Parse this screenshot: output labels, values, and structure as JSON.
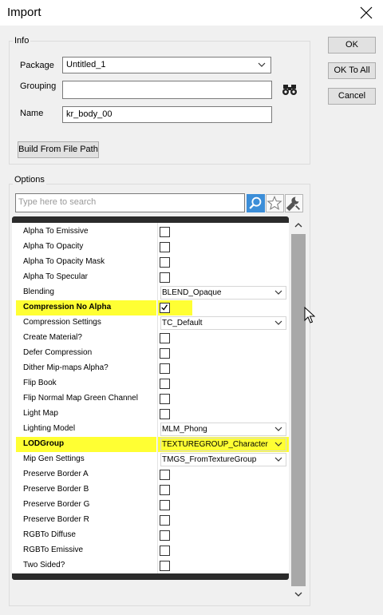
{
  "window": {
    "title": "Import"
  },
  "buttons": {
    "ok": "OK",
    "ok_to_all": "OK To All",
    "cancel": "Cancel"
  },
  "info": {
    "label": "Info",
    "package_label": "Package",
    "package_value": "Untitled_1",
    "grouping_label": "Grouping",
    "grouping_value": "",
    "name_label": "Name",
    "name_value": "kr_body_00",
    "build_button": "Build From File Path"
  },
  "options": {
    "label": "Options",
    "search_placeholder": "Type here to search",
    "rows": [
      {
        "name": "Alpha To Emissive",
        "type": "checkbox",
        "checked": false
      },
      {
        "name": "Alpha To Opacity",
        "type": "checkbox",
        "checked": false
      },
      {
        "name": "Alpha To Opacity Mask",
        "type": "checkbox",
        "checked": false
      },
      {
        "name": "Alpha To Specular",
        "type": "checkbox",
        "checked": false
      },
      {
        "name": "Blending",
        "type": "dropdown",
        "value": "BLEND_Opaque"
      },
      {
        "name": "Compression No Alpha",
        "type": "checkbox",
        "checked": true,
        "highlight": true
      },
      {
        "name": "Compression Settings",
        "type": "dropdown",
        "value": "TC_Default"
      },
      {
        "name": "Create Material?",
        "type": "checkbox",
        "checked": false
      },
      {
        "name": "Defer Compression",
        "type": "checkbox",
        "checked": false
      },
      {
        "name": "Dither Mip-maps Alpha?",
        "type": "checkbox",
        "checked": false
      },
      {
        "name": "Flip Book",
        "type": "checkbox",
        "checked": false
      },
      {
        "name": "Flip Normal Map Green Channel",
        "type": "checkbox",
        "checked": false
      },
      {
        "name": "Light Map",
        "type": "checkbox",
        "checked": false
      },
      {
        "name": "Lighting Model",
        "type": "dropdown",
        "value": "MLM_Phong"
      },
      {
        "name": "LODGroup",
        "type": "dropdown",
        "value": "TEXTUREGROUP_Character",
        "highlight": true
      },
      {
        "name": "Mip Gen Settings",
        "type": "dropdown",
        "value": "TMGS_FromTextureGroup"
      },
      {
        "name": "Preserve Border A",
        "type": "checkbox",
        "checked": false
      },
      {
        "name": "Preserve Border B",
        "type": "checkbox",
        "checked": false
      },
      {
        "name": "Preserve Border G",
        "type": "checkbox",
        "checked": false
      },
      {
        "name": "Preserve Border R",
        "type": "checkbox",
        "checked": false
      },
      {
        "name": "RGBTo Diffuse",
        "type": "checkbox",
        "checked": false
      },
      {
        "name": "RGBTo Emissive",
        "type": "checkbox",
        "checked": false
      },
      {
        "name": "Two Sided?",
        "type": "checkbox",
        "checked": false
      }
    ]
  },
  "colors": {
    "highlight": "#ffff33",
    "header_bar": "#2b2b2b",
    "search_button": "#3c8ed8"
  },
  "icons": {
    "close": "close-icon",
    "browse": "binoculars-icon",
    "search": "magnifier-icon",
    "favorite": "star-icon",
    "settings": "wrench-icon"
  }
}
